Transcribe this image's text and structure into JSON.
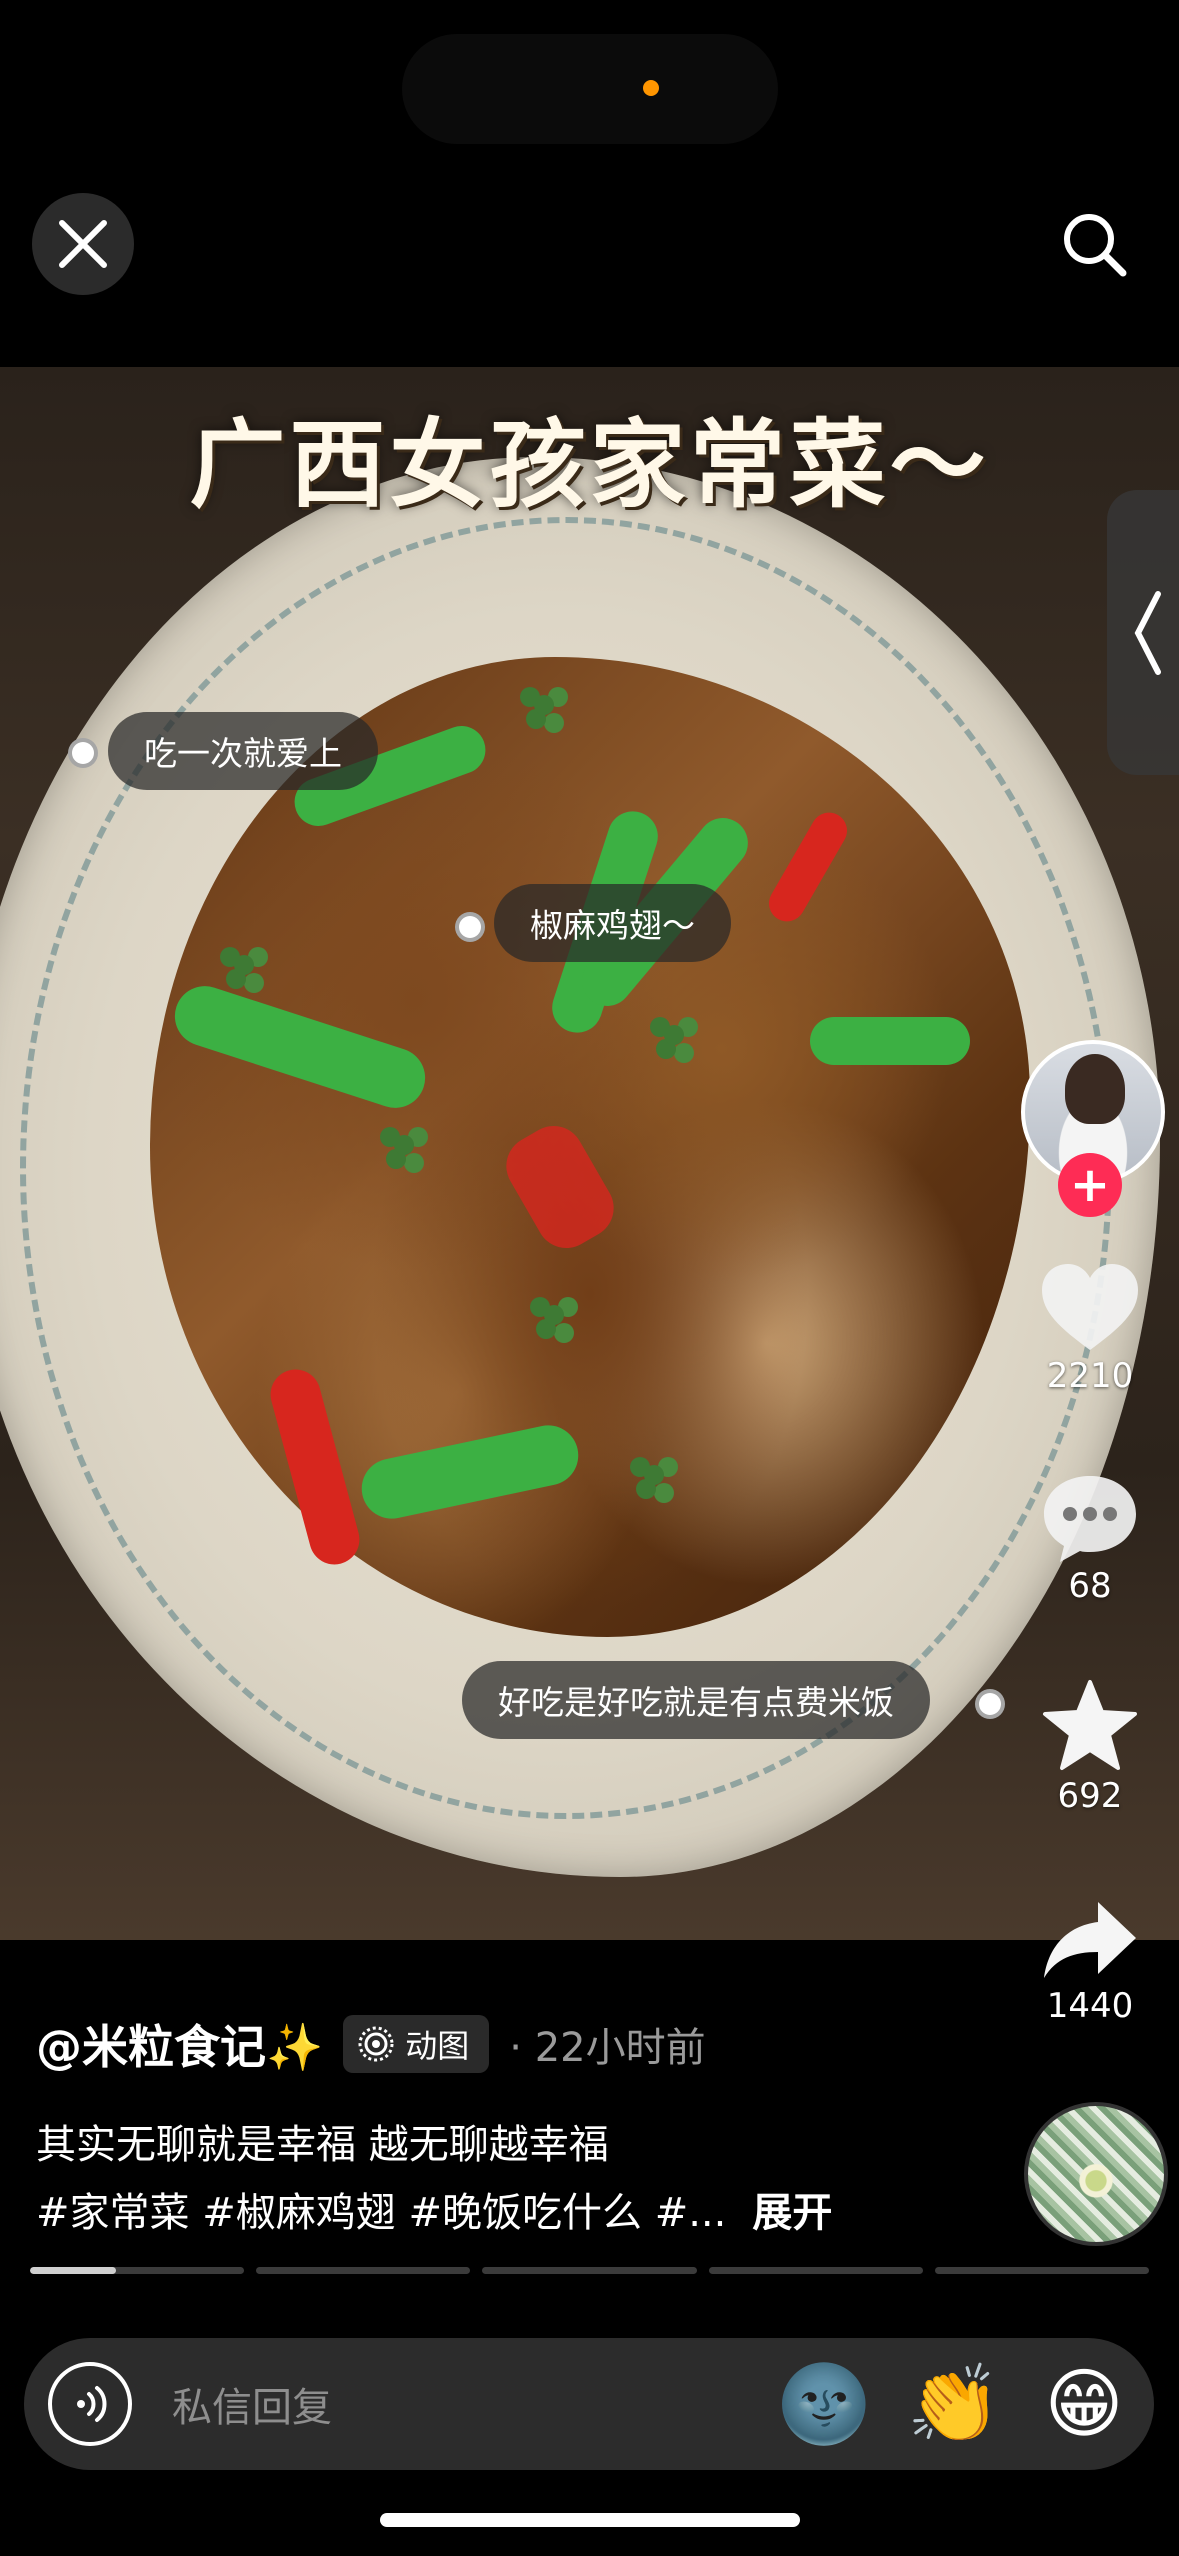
{
  "header": {
    "close_icon": "close-icon",
    "search_icon": "search-icon"
  },
  "photo": {
    "title_overlay": "广西女孩家常菜～",
    "tags": [
      "吃一次就爱上",
      "椒麻鸡翅～",
      "好吃是好吃就是有点费米饭"
    ]
  },
  "actions": {
    "likes": "2210",
    "comments": "68",
    "favorites": "692",
    "shares": "1440",
    "follow_label": "+"
  },
  "post": {
    "author": "@米粒食记✨",
    "badge": "动图",
    "time": "· 22小时前",
    "caption_line1": "其实无聊就是幸福 越无聊越幸福",
    "caption_line2": "#家常菜 #椒麻鸡翅 #晚饭吃什么 #...",
    "expand_label": "展开"
  },
  "progress": {
    "segments": 5,
    "current": 1,
    "current_fraction": 0.4
  },
  "reply_bar": {
    "placeholder": "私信回复",
    "emojis": [
      "🌚",
      "👏",
      "😁"
    ]
  },
  "colors": {
    "accent": "#fe2c55",
    "background": "#000000"
  }
}
